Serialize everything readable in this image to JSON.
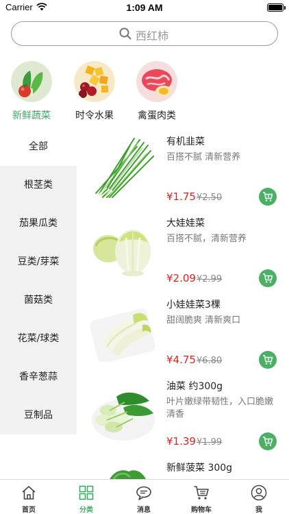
{
  "status_bar": {
    "carrier": "Carrier",
    "time": "1:09 AM"
  },
  "search": {
    "placeholder": "西红柿"
  },
  "top_categories": [
    {
      "label": "新鲜蔬菜",
      "icon": "vegetables-image",
      "active": true
    },
    {
      "label": "时令水果",
      "icon": "fruits-image",
      "active": false
    },
    {
      "label": "禽蛋肉类",
      "icon": "meat-image",
      "active": false
    }
  ],
  "sidebar": {
    "items": [
      {
        "label": "全部",
        "active": true
      },
      {
        "label": "根茎类",
        "active": false
      },
      {
        "label": "茄果瓜类",
        "active": false
      },
      {
        "label": "豆类/芽菜",
        "active": false
      },
      {
        "label": "菌菇类",
        "active": false
      },
      {
        "label": "花菜/球类",
        "active": false
      },
      {
        "label": "香辛葱蒜",
        "active": false
      },
      {
        "label": "豆制品",
        "active": false
      }
    ]
  },
  "products": [
    {
      "name": "有机韭菜",
      "desc": "百搭不腻 清新营养",
      "price": "¥1.75",
      "old_price": "¥2.50",
      "image": "chives-image"
    },
    {
      "name": "大娃娃菜",
      "desc": "百搭不腻，清新营养",
      "price": "¥2.09",
      "old_price": "¥2.99",
      "image": "napa-cabbage-image"
    },
    {
      "name": "小娃娃菜3棵",
      "desc": "甜阔脆爽 清新爽口",
      "price": "¥4.75",
      "old_price": "¥6.80",
      "image": "baby-cabbage-image"
    },
    {
      "name": "油菜 约300g",
      "desc": "叶片嫩绿带韧性，入口脆嫩清香",
      "price": "¥1.39",
      "old_price": "¥1.99",
      "image": "bok-choy-image"
    },
    {
      "name": "新鲜菠菜 300g",
      "desc": "",
      "price": "",
      "old_price": "",
      "image": "spinach-image"
    }
  ],
  "tab_bar": {
    "tabs": [
      {
        "label": "首页",
        "icon": "home-icon",
        "active": false
      },
      {
        "label": "分类",
        "icon": "category-grid-icon",
        "active": true
      },
      {
        "label": "消息",
        "icon": "message-icon",
        "active": false
      },
      {
        "label": "购物车",
        "icon": "cart-icon",
        "active": false
      },
      {
        "label": "我",
        "icon": "profile-icon",
        "active": false
      }
    ]
  },
  "colors": {
    "accent": "#3daa63",
    "price": "#e02020",
    "sidebar_bg": "#f2f2f2",
    "cart_button": "#4caf66"
  }
}
